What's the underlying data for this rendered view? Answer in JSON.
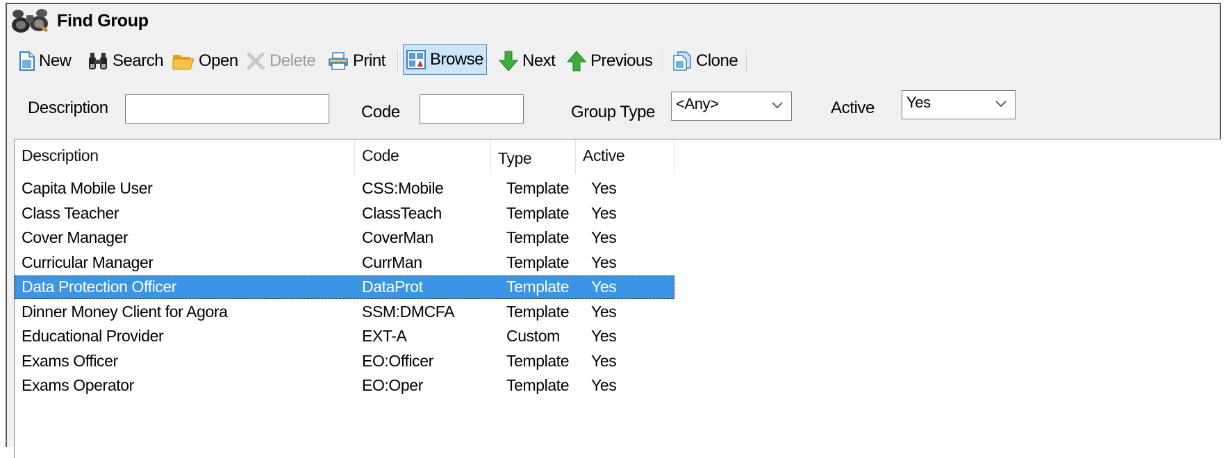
{
  "window": {
    "title": "Find Group"
  },
  "toolbar": {
    "new_label": "New",
    "search_label": "Search",
    "open_label": "Open",
    "delete_label": "Delete",
    "print_label": "Print",
    "browse_label": "Browse",
    "next_label": "Next",
    "previous_label": "Previous",
    "clone_label": "Clone"
  },
  "filters": {
    "description_label": "Description",
    "description_value": "",
    "code_label": "Code",
    "code_value": "",
    "group_type_label": "Group Type",
    "group_type_value": "<Any>",
    "active_label": "Active",
    "active_value": "Yes"
  },
  "grid": {
    "columns": [
      "Description",
      "Code",
      "Type",
      "Active"
    ],
    "rows": [
      {
        "description": "Capita Mobile User",
        "code": "CSS:Mobile",
        "type": "Template",
        "active": "Yes"
      },
      {
        "description": "Class Teacher",
        "code": "ClassTeach",
        "type": "Template",
        "active": "Yes"
      },
      {
        "description": "Cover Manager",
        "code": "CoverMan",
        "type": "Template",
        "active": "Yes"
      },
      {
        "description": "Curricular Manager",
        "code": "CurrMan",
        "type": "Template",
        "active": "Yes"
      },
      {
        "description": "Data Protection Officer",
        "code": "DataProt",
        "type": "Template",
        "active": "Yes",
        "selected": true
      },
      {
        "description": "Dinner Money Client for Agora",
        "code": "SSM:DMCFA",
        "type": "Template",
        "active": "Yes"
      },
      {
        "description": "Educational Provider",
        "code": "EXT-A",
        "type": "Custom",
        "active": "Yes"
      },
      {
        "description": "Exams Officer",
        "code": "EO:Officer",
        "type": "Template",
        "active": "Yes"
      },
      {
        "description": "Exams Operator",
        "code": "EO:Oper",
        "type": "Template",
        "active": "Yes"
      }
    ]
  },
  "colors": {
    "selection": "#3a95e6",
    "window_bg": "#f0f0f0"
  }
}
